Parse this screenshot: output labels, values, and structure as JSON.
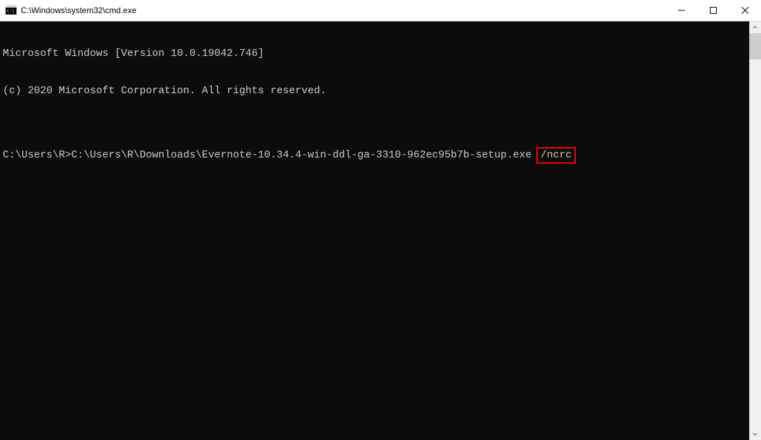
{
  "window": {
    "title": "C:\\Windows\\system32\\cmd.exe"
  },
  "terminal": {
    "line1": "Microsoft Windows [Version 10.0.19042.746]",
    "line2": "(c) 2020 Microsoft Corporation. All rights reserved.",
    "blank": "",
    "prompt_prefix": "C:\\Users\\R>",
    "command_path": "C:\\Users\\R\\Downloads\\Evernote-10.34.4-win-ddl-ga-3310-962ec95b7b-setup.exe ",
    "command_flag": "/ncrc"
  }
}
